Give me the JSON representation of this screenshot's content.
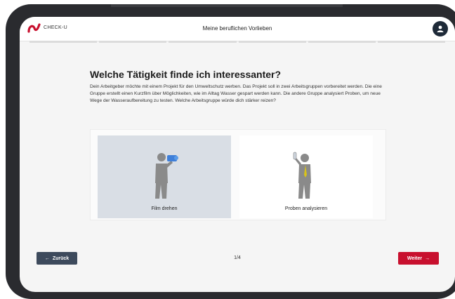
{
  "app": {
    "brand_text": "CHECK-U",
    "header_title": "Meine beruflichen Vorlieben"
  },
  "progress": {
    "segments": 6,
    "active_segments": 0
  },
  "question": {
    "title": "Welche Tätigkeit finde ich interessanter?",
    "description": "Dein Arbeitgeber möchte mit einem Projekt für den Umweltschutz werben. Das Projekt soll in zwei Arbeitsgruppen vorbereitet werden. Die eine Gruppe erstellt einen Kurzfilm über Möglichkeiten, wie im Alltag Wasser gespart werden kann. Die andere Gruppe analysiert Proben, um neue Wege der Wasseraufbereitung zu testen. Welche Arbeitsgruppe würde dich stärker reizen?"
  },
  "options": [
    {
      "label": "Film drehen",
      "icon": "person-with-camera-icon",
      "selected": true
    },
    {
      "label": "Proben analysieren",
      "icon": "person-with-test-tube-icon",
      "selected": false
    }
  ],
  "footer": {
    "back_label": "Zurück",
    "next_label": "Weiter",
    "page_indicator": "1/4"
  },
  "colors": {
    "accent": "#c8102e",
    "back_button": "#3d4a5c",
    "selected_card": "#d9dee5"
  }
}
